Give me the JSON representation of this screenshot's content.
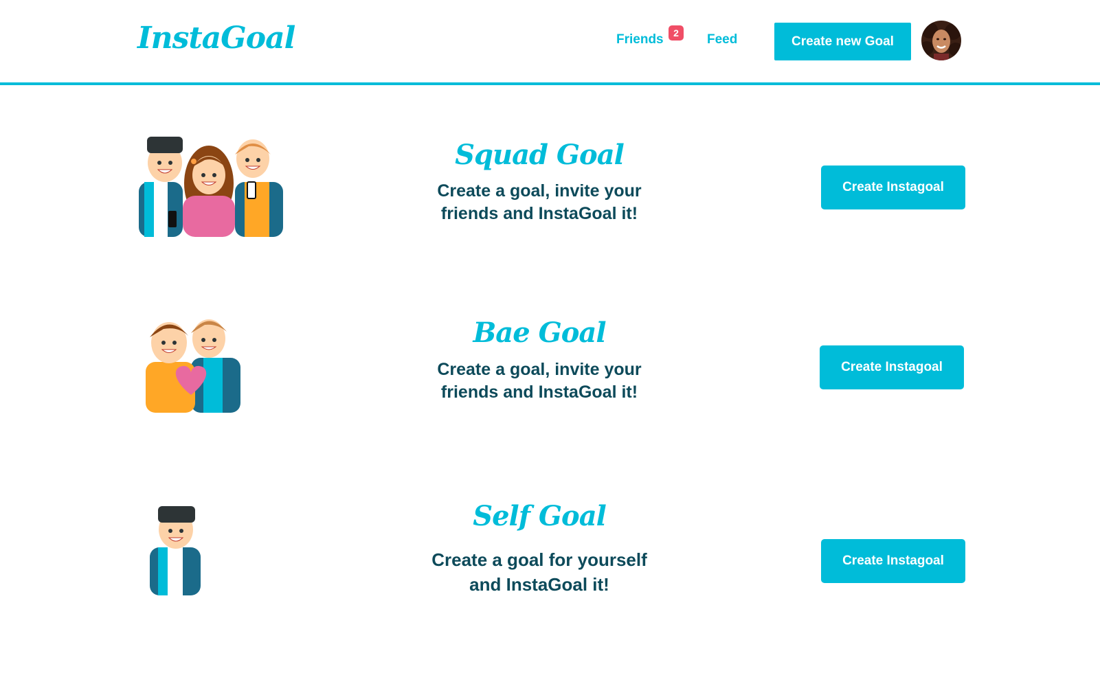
{
  "header": {
    "logo": "InstaGoal",
    "friends_label": "Friends",
    "friends_badge": "2",
    "feed_label": "Feed",
    "create_button": "Create new Goal"
  },
  "goals": [
    {
      "title": "Squad Goal",
      "line1": "Create a goal, invite your",
      "line2": "friends and InstaGoal it!",
      "button": "Create Instagoal"
    },
    {
      "title": "Bae Goal",
      "line1": "Create a goal, invite your",
      "line2": "friends and InstaGoal it!",
      "button": "Create Instagoal"
    },
    {
      "title": "Self Goal",
      "line1": "Create a goal for yourself",
      "line2": "and InstaGoal it!",
      "button": "Create Instagoal"
    }
  ],
  "colors": {
    "accent": "#00bcd9",
    "text_dark": "#0d4a5a",
    "badge": "#f04e66"
  }
}
